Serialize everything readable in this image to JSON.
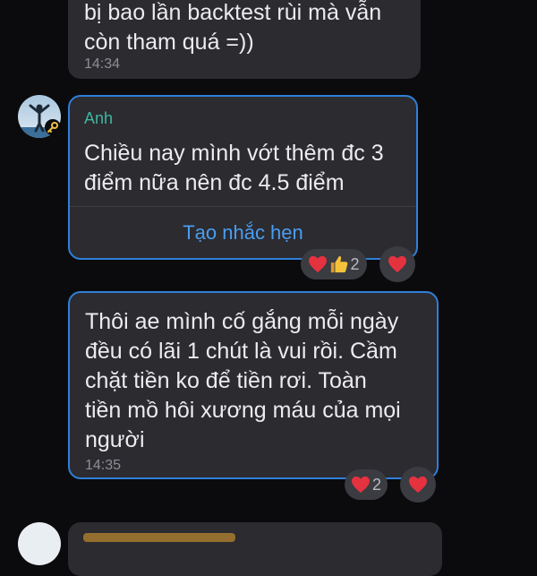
{
  "messages": [
    {
      "text_line1": "bị bao lần backtest rùi mà vẫn",
      "text_line2": "còn tham quá =))",
      "time": "14:34"
    },
    {
      "sender": "Anh",
      "text_line1": "Chiều nay mình vớt thêm đc 3",
      "text_line2": "điểm nữa nên đc 4.5 điểm",
      "action": "Tạo nhắc hẹn",
      "reaction_count": "2"
    },
    {
      "lines": [
        "Thôi ae mình cố gắng mỗi ngày",
        "đều có lãi 1 chút là vui rồi. Cầm",
        "chặt tiền ko để tiền rơi. Toàn",
        "tiền mồ hôi xương máu của mọi",
        "người"
      ],
      "time": "14:35",
      "reaction_count": "2"
    }
  ],
  "colors": {
    "background": "#0b0b0d",
    "bubble": "#2b2b30",
    "selected_border": "#2f7fd8",
    "sender_name": "#3fb6a0",
    "action_link": "#4a9df0",
    "heart": "#e5323f"
  },
  "icons": [
    "avatar",
    "key-badge-icon",
    "heart-icon",
    "thumbs-up-icon"
  ]
}
